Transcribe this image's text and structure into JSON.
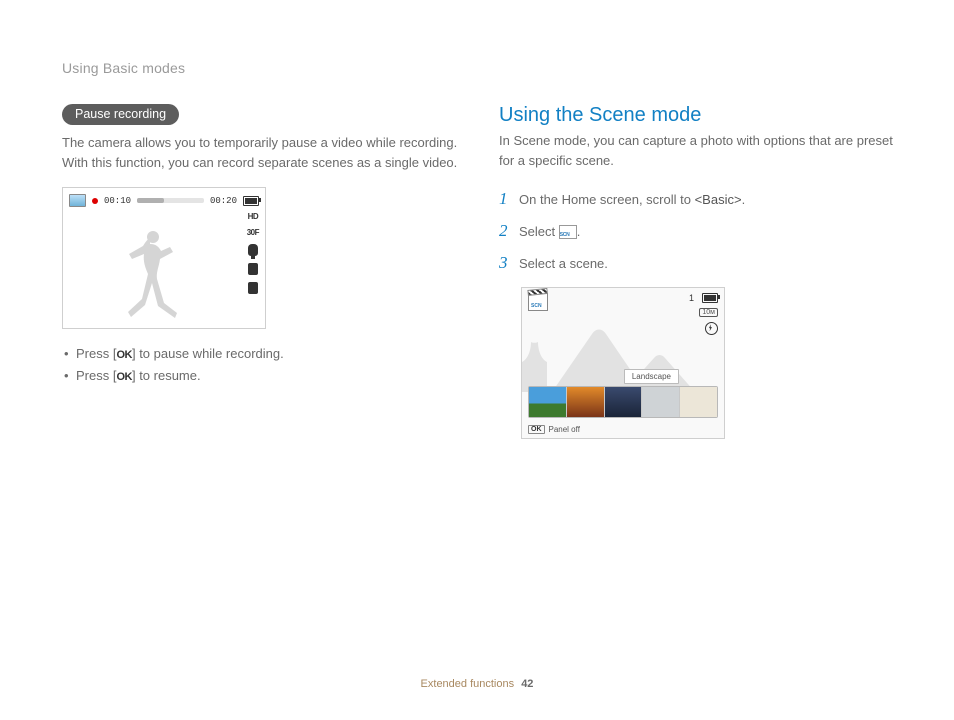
{
  "breadcrumb": "Using Basic modes",
  "left": {
    "pill": "Pause recording",
    "intro": "The camera allows you to temporarily pause a video while recording. With this function, you can record separate scenes as a single video.",
    "video": {
      "t1": "00:10",
      "t2": "00:20",
      "hd": "HD",
      "fps": "30F"
    },
    "b1_pre": "Press [",
    "b1_post": "] to pause while recording.",
    "b2_pre": "Press [",
    "b2_post": "] to resume.",
    "ok": "OK"
  },
  "right": {
    "title": "Using the Scene mode",
    "intro": "In Scene mode, you can capture a photo with options that are preset for a specific scene.",
    "s1_pre": "On the Home screen, scroll to ",
    "s1_em": "<Basic>",
    "s1_post": ".",
    "s2_pre": "Select ",
    "s2_post": ".",
    "s3": "Select a scene.",
    "scene": {
      "count": "1",
      "label": "Landscape",
      "panel": "Panel off",
      "ok": "OK"
    }
  },
  "footer": {
    "section": "Extended functions",
    "page": "42"
  }
}
